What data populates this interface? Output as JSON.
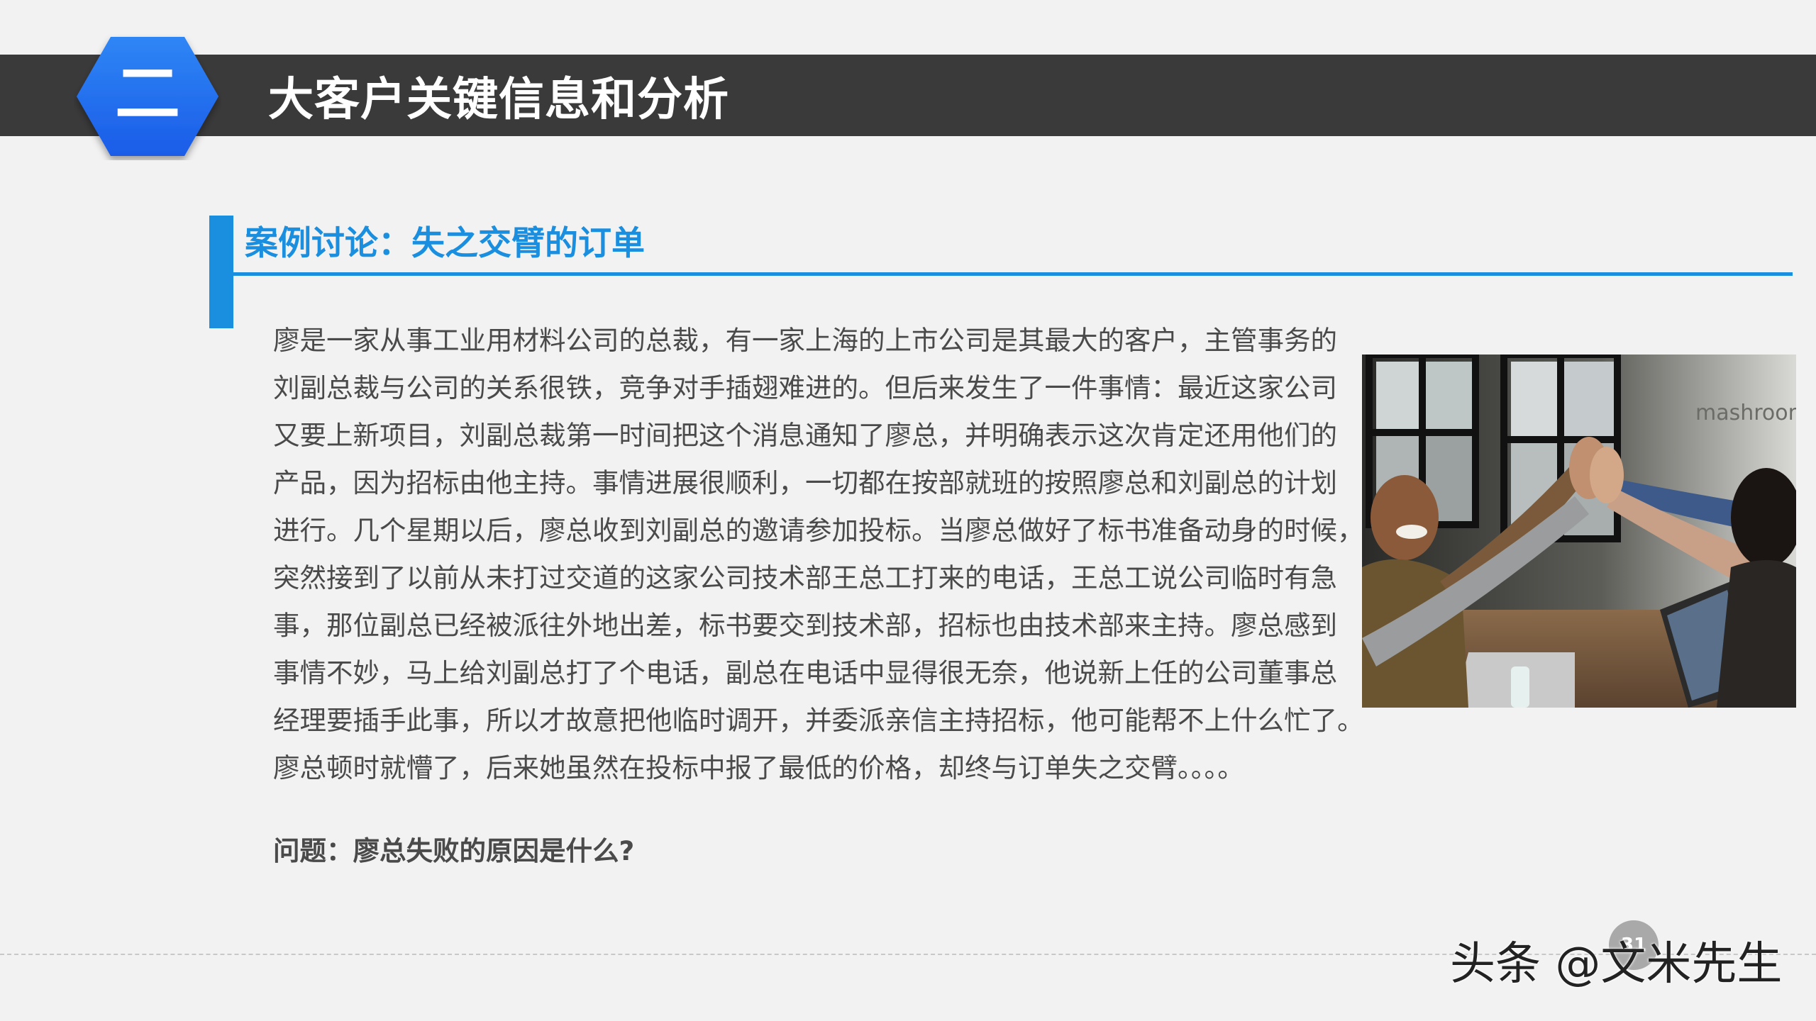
{
  "header": {
    "section_number": "二",
    "section_title": "大客户关键信息和分析"
  },
  "case": {
    "title": "案例讨论：失之交臂的订单",
    "body_lines": [
      "廖是一家从事工业用材料公司的总裁，有一家上海的上市公司是其最大的客户，主管事务的",
      "刘副总裁与公司的关系很铁，竞争对手插翅难进的。但后来发生了一件事情：最近这家公司",
      "又要上新项目，刘副总裁第一时间把这个消息通知了廖总，并明确表示这次肯定还用他们的",
      "产品，因为招标由他主持。事情进展很顺利，一切都在按部就班的按照廖总和刘副总的计划",
      "进行。几个星期以后，廖总收到刘副总的邀请参加投标。当廖总做好了标书准备动身的时候，",
      "突然接到了以前从未打过交道的这家公司技术部王总工打来的电话，王总工说公司临时有急",
      "事，那位副总已经被派往外地出差，标书要交到技术部，招标也由技术部来主持。廖总感到",
      "事情不妙，马上给刘副总打了个电话，副总在电话中显得很无奈，他说新上任的公司董事总",
      "经理要插手此事，所以才故意把他临时调开，并委派亲信主持招标，他可能帮不上什么忙了。",
      "廖总顿时就懵了，后来她虽然在投标中报了最低的价格，却终与订单失之交臂。。。。"
    ],
    "question": "问题：廖总失败的原因是什么?"
  },
  "photo": {
    "wall_sign_text": "mashroom"
  },
  "footer": {
    "page_number": "31",
    "watermark": "头条 @文米先生"
  },
  "colors": {
    "accent_blue": "#1a8fe0",
    "hex_blue": "#1f6cf0",
    "header_bar": "#3a3a3b",
    "body_text": "#4a4a4a",
    "background": "#f2f2f2"
  }
}
